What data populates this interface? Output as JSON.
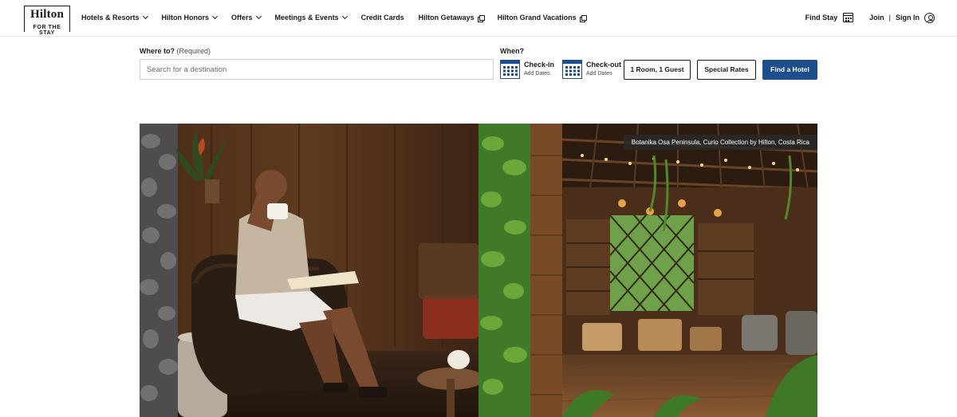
{
  "brand": {
    "name": "Hilton",
    "tagline": "FOR THE STAY"
  },
  "nav": {
    "items": [
      {
        "label": "Hotels & Resorts",
        "indicator": "chevron-down-icon"
      },
      {
        "label": "Hilton Honors",
        "indicator": "chevron-down-icon"
      },
      {
        "label": "Offers",
        "indicator": "chevron-down-icon"
      },
      {
        "label": "Meetings & Events",
        "indicator": "chevron-down-icon"
      },
      {
        "label": "Credit Cards",
        "indicator": ""
      },
      {
        "label": "Hilton Getaways",
        "indicator": "external-link-icon"
      },
      {
        "label": "Hilton Grand Vacations",
        "indicator": "external-link-icon"
      }
    ]
  },
  "account": {
    "find_stay": "Find Stay",
    "join": "Join",
    "separator": "|",
    "sign_in": "Sign In"
  },
  "search": {
    "where_label": "Where to?",
    "where_required": "(Required)",
    "placeholder": "Search for a destination",
    "value": "",
    "when_label": "When?",
    "checkin_title": "Check-in",
    "checkin_sub": "Add Dates",
    "checkout_title": "Check-out",
    "checkout_sub": "Add Dates",
    "rooms_button": "1 Room, 1 Guest",
    "rates_button": "Special Rates",
    "find_button": "Find a Hotel"
  },
  "hero": {
    "caption": "Botanika Osa Peninsula, Curio Collection by Hilton, Costa Rica"
  },
  "colors": {
    "accent": "#1c4d8c",
    "text": "#1a1a1a",
    "border": "#cfcfcf"
  }
}
